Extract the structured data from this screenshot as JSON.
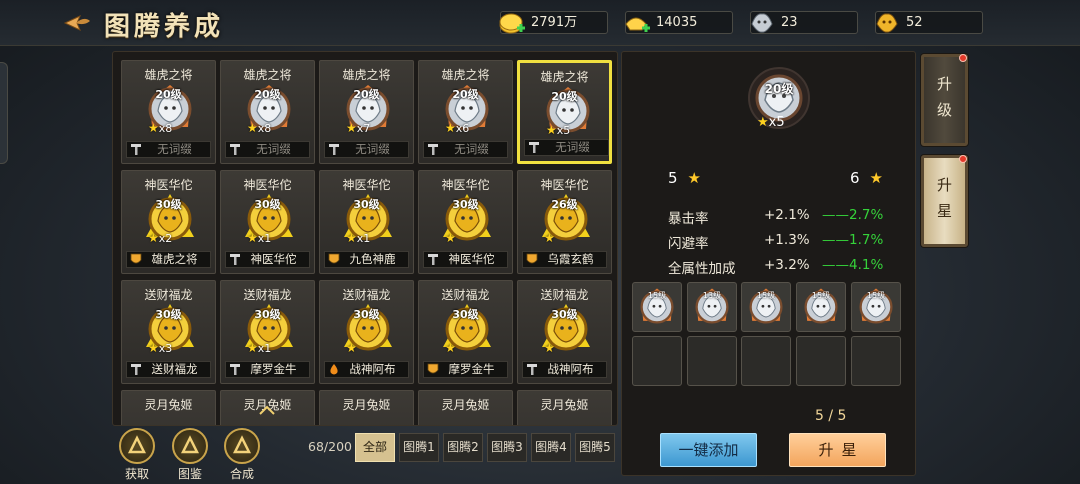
{
  "header": {
    "title": "图腾养成",
    "resources": [
      {
        "icon": "gold-coin-add-icon",
        "value": "2791万"
      },
      {
        "icon": "gold-ingot-add-icon",
        "value": "14035"
      },
      {
        "icon": "silver-beast-icon",
        "value": "23"
      },
      {
        "icon": "gold-beast-icon",
        "value": "52"
      }
    ]
  },
  "grid": {
    "rows": [
      [
        {
          "name": "雄虎之将",
          "level": "20级",
          "stars": "x8",
          "slot": "无词缀",
          "slot_icon": "sword-icon",
          "kind": "silver",
          "selected": false
        },
        {
          "name": "雄虎之将",
          "level": "20级",
          "stars": "x8",
          "slot": "无词缀",
          "slot_icon": "sword-icon",
          "kind": "silver",
          "selected": false
        },
        {
          "name": "雄虎之将",
          "level": "20级",
          "stars": "x7",
          "slot": "无词缀",
          "slot_icon": "sword-icon",
          "kind": "silver",
          "selected": false
        },
        {
          "name": "雄虎之将",
          "level": "20级",
          "stars": "x6",
          "slot": "无词缀",
          "slot_icon": "sword-icon",
          "kind": "silver",
          "selected": false
        },
        {
          "name": "雄虎之将",
          "level": "20级",
          "stars": "x5",
          "slot": "无词缀",
          "slot_icon": "sword-icon",
          "kind": "silver",
          "selected": true
        }
      ],
      [
        {
          "name": "神医华佗",
          "level": "30级",
          "stars": "x2",
          "slot": "雄虎之将",
          "slot_icon": "shield-icon",
          "kind": "gold",
          "selected": false
        },
        {
          "name": "神医华佗",
          "level": "30级",
          "stars": "x1",
          "slot": "神医华佗",
          "slot_icon": "sword-icon",
          "kind": "gold",
          "selected": false
        },
        {
          "name": "神医华佗",
          "level": "30级",
          "stars": "x1",
          "slot": "九色神鹿",
          "slot_icon": "shield-icon",
          "kind": "gold",
          "selected": false
        },
        {
          "name": "神医华佗",
          "level": "30级",
          "stars": "",
          "slot": "神医华佗",
          "slot_icon": "sword-icon",
          "kind": "gold",
          "selected": false
        },
        {
          "name": "神医华佗",
          "level": "26级",
          "stars": "",
          "slot": "乌霞玄鹤",
          "slot_icon": "shield-icon",
          "kind": "gold",
          "selected": false
        }
      ],
      [
        {
          "name": "送财福龙",
          "level": "30级",
          "stars": "x3",
          "slot": "送财福龙",
          "slot_icon": "sword-icon",
          "kind": "gold",
          "selected": false
        },
        {
          "name": "送财福龙",
          "level": "30级",
          "stars": "x1",
          "slot": "摩罗金牛",
          "slot_icon": "sword-icon",
          "kind": "gold",
          "selected": false
        },
        {
          "name": "送财福龙",
          "level": "30级",
          "stars": "",
          "slot": "战神阿布",
          "slot_icon": "drop-icon",
          "kind": "gold",
          "selected": false
        },
        {
          "name": "送财福龙",
          "level": "30级",
          "stars": "",
          "slot": "摩罗金牛",
          "slot_icon": "shield-icon",
          "kind": "gold",
          "selected": false
        },
        {
          "name": "送财福龙",
          "level": "30级",
          "stars": "",
          "slot": "战神阿布",
          "slot_icon": "sword-icon",
          "kind": "gold",
          "selected": false
        }
      ],
      [
        {
          "name": "灵月兔姬"
        },
        {
          "name": "灵月兔姬"
        },
        {
          "name": "灵月兔姬"
        },
        {
          "name": "灵月兔姬"
        },
        {
          "name": "灵月兔姬"
        }
      ]
    ]
  },
  "bottom_buttons": [
    {
      "label": "获取",
      "icon": "obtain-icon"
    },
    {
      "label": "图鉴",
      "icon": "codex-icon"
    },
    {
      "label": "合成",
      "icon": "synthesize-icon"
    }
  ],
  "count": "68/200",
  "filter_tabs": [
    "全部",
    "图腾1",
    "图腾2",
    "图腾3",
    "图腾4",
    "图腾5"
  ],
  "active_filter": 0,
  "detail": {
    "level": "20级",
    "stars": "x5",
    "star_from": "5",
    "star_to": "6",
    "stats": [
      {
        "name": "暴击率",
        "current": "+2.1%",
        "next": "2.7%"
      },
      {
        "name": "闪避率",
        "current": "+1.3%",
        "next": "1.7%"
      },
      {
        "name": "全属性加成",
        "current": "+3.2%",
        "next": "4.1%"
      }
    ],
    "materials": [
      {
        "level": "15级"
      },
      {
        "level": "13级"
      },
      {
        "level": "15级"
      },
      {
        "level": "15级"
      },
      {
        "level": "15级"
      }
    ],
    "progress": "5 / 5",
    "auto_add_label": "一键添加",
    "upgrade_star_label": "升星"
  },
  "side_tabs": [
    {
      "label": "升\n级",
      "active": false
    },
    {
      "label": "升\n星",
      "active": true
    }
  ],
  "colors": {
    "gold": "#e9b21c",
    "silver": "#b8c0c8",
    "green": "#35d23a",
    "select": "#f0e040"
  }
}
